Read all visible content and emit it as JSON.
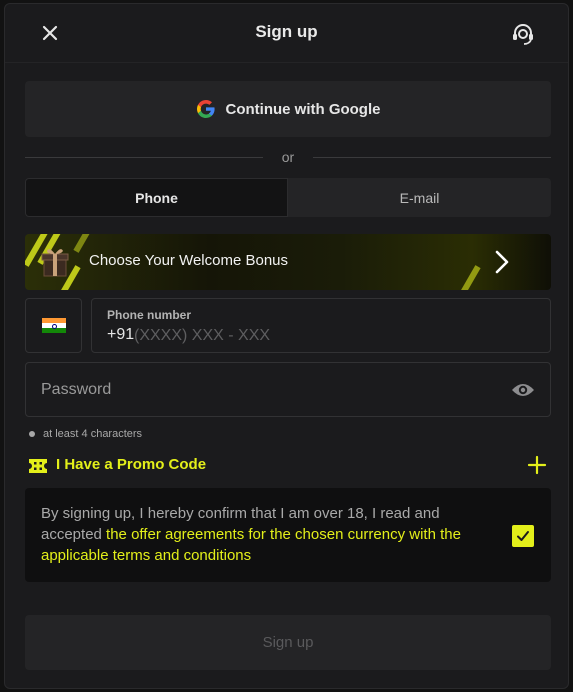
{
  "header": {
    "title": "Sign up",
    "close_icon": "close-icon",
    "support_icon": "headset-support-icon"
  },
  "google": {
    "label": "Continue with Google",
    "icon": "google-logo-icon"
  },
  "divider": {
    "text": "or"
  },
  "tabs": [
    {
      "label": "Phone",
      "active": true
    },
    {
      "label": "E-mail",
      "active": false
    }
  ],
  "bonus": {
    "label": "Choose Your Welcome Bonus",
    "icon": "gift-box-icon",
    "accent": "#d8e51c"
  },
  "phone": {
    "country_flag": "india-flag-icon",
    "label": "Phone number",
    "code": "+91",
    "placeholder": "(XXXX) XXX - XXX"
  },
  "password": {
    "placeholder": "Password",
    "icon": "eye-icon",
    "hint": "at least 4 characters"
  },
  "promo": {
    "label": "I Have a Promo Code",
    "icon": "ticket-icon",
    "expand_icon": "plus-icon"
  },
  "terms": {
    "text_plain": "By signing up, I hereby confirm that I am over 18, I read and accepted ",
    "text_link": "the offer agreements for the chosen currency with the applicable terms and conditions",
    "checked": true
  },
  "submit": {
    "label": "Sign up"
  },
  "colors": {
    "accent": "#e3ef1a",
    "background": "#1b1b1d",
    "surface": "#242426"
  }
}
